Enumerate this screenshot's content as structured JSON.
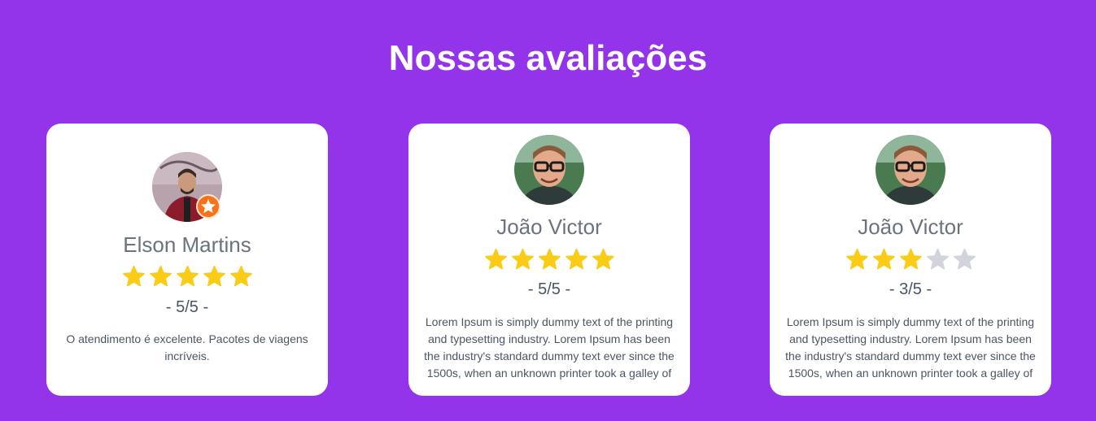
{
  "section": {
    "title": "Nossas avaliações"
  },
  "colors": {
    "background": "#9333ea",
    "card": "#ffffff",
    "star_filled": "#facc15",
    "star_empty": "#d1d5db",
    "badge": "#f97316"
  },
  "reviews": [
    {
      "name": "Elson Martins",
      "avatar_icon": "user-avatar-photo",
      "badge_icon": "star-badge-icon",
      "rating": 5,
      "rating_max": 5,
      "score_text": "- 5/5 -",
      "text": "O atendimento é excelente. Pacotes de viagens incríveis."
    },
    {
      "name": "João Victor",
      "avatar_icon": "user-avatar-photo",
      "rating": 5,
      "rating_max": 5,
      "score_text": "- 5/5 -",
      "text": "Lorem Ipsum is simply dummy text of the printing and typesetting industry. Lorem Ipsum has been the industry's standard dummy text ever since the 1500s, when an unknown printer took a galley of"
    },
    {
      "name": "João Victor",
      "avatar_icon": "user-avatar-photo",
      "rating": 3,
      "rating_max": 5,
      "score_text": "- 3/5 -",
      "text": "Lorem Ipsum is simply dummy text of the printing and typesetting industry. Lorem Ipsum has been the industry's standard dummy text ever since the 1500s, when an unknown printer took a galley of"
    }
  ]
}
